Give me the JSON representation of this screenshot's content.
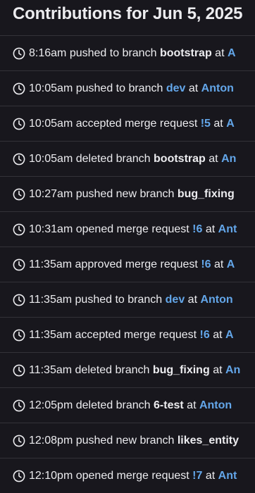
{
  "title": "Contributions for Jun 5, 2025",
  "icon": "clock-icon",
  "colors": {
    "background": "#18171d",
    "text": "#ececef",
    "link": "#63a6e9",
    "divider": "#333238"
  },
  "events": [
    {
      "time": "8:16am",
      "action": "pushed to branch",
      "target": "bootstrap",
      "target_style": "bold",
      "suffix": "at",
      "project": "A"
    },
    {
      "time": "10:05am",
      "action": "pushed to branch",
      "target": "dev",
      "target_style": "link",
      "suffix": "at",
      "project": "Anton"
    },
    {
      "time": "10:05am",
      "action": "accepted merge request",
      "target": "!5",
      "target_style": "link",
      "suffix": "at",
      "project": "A"
    },
    {
      "time": "10:05am",
      "action": "deleted branch",
      "target": "bootstrap",
      "target_style": "bold",
      "suffix": "at",
      "project": "An"
    },
    {
      "time": "10:27am",
      "action": "pushed new branch",
      "target": "bug_fixing",
      "target_style": "bold",
      "suffix": "",
      "project": ""
    },
    {
      "time": "10:31am",
      "action": "opened merge request",
      "target": "!6",
      "target_style": "link",
      "suffix": "at",
      "project": "Ant"
    },
    {
      "time": "11:35am",
      "action": "approved merge request",
      "target": "!6",
      "target_style": "link",
      "suffix": "at",
      "project": "A"
    },
    {
      "time": "11:35am",
      "action": "pushed to branch",
      "target": "dev",
      "target_style": "link",
      "suffix": "at",
      "project": "Anton"
    },
    {
      "time": "11:35am",
      "action": "accepted merge request",
      "target": "!6",
      "target_style": "link",
      "suffix": "at",
      "project": "A"
    },
    {
      "time": "11:35am",
      "action": "deleted branch",
      "target": "bug_fixing",
      "target_style": "bold",
      "suffix": "at",
      "project": "An"
    },
    {
      "time": "12:05pm",
      "action": "deleted branch",
      "target": "6-test",
      "target_style": "bold",
      "suffix": "at",
      "project": "Anton"
    },
    {
      "time": "12:08pm",
      "action": "pushed new branch",
      "target": "likes_entity",
      "target_style": "bold",
      "suffix": "",
      "project": ""
    },
    {
      "time": "12:10pm",
      "action": "opened merge request",
      "target": "!7",
      "target_style": "link",
      "suffix": "at",
      "project": "Ant"
    }
  ]
}
